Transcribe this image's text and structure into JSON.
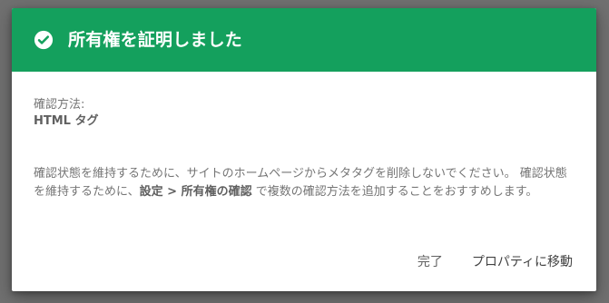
{
  "dialog": {
    "title": "所有権を証明しました",
    "icon": "check-circle-icon",
    "header_color": "#14a05d",
    "method_label": "確認方法:",
    "method_value": "HTML タグ",
    "description_part1": "確認状態を維持するために、サイトのホームページからメタタグを削除しないでください。 確認状態を維持するために、",
    "description_strong": "設定 > 所有権の確認",
    "description_part2": " で複数の確認方法を追加することをおすすめします。",
    "done_button": "完了",
    "goto_property_button": "プロパティに移動"
  }
}
